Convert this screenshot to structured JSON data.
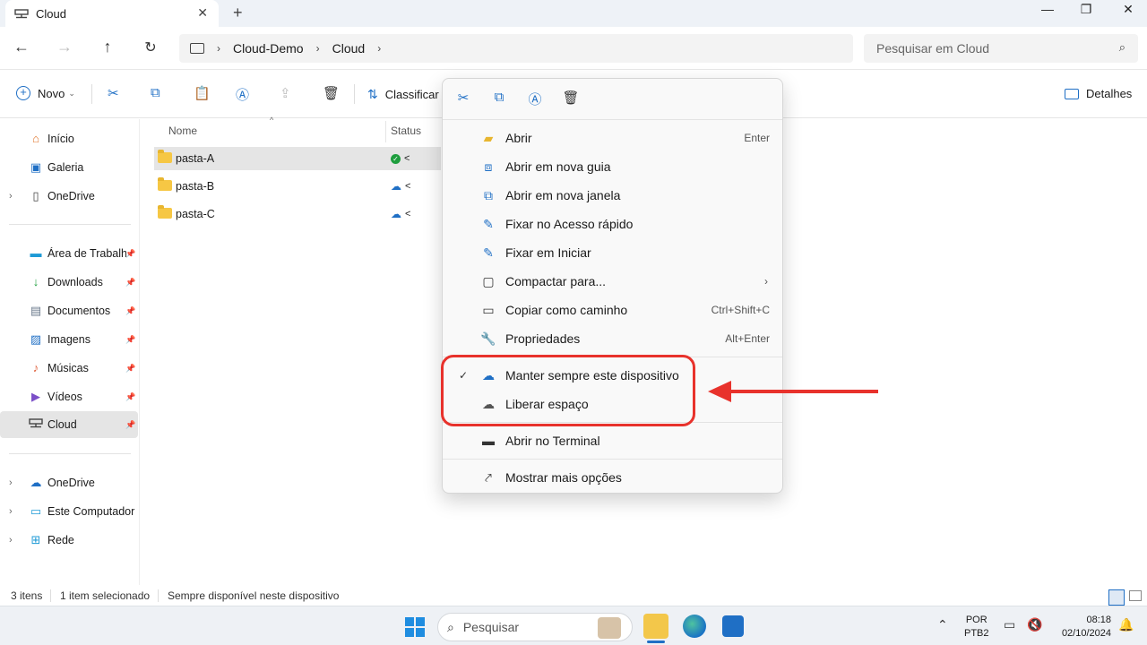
{
  "window": {
    "tab_title": "Cloud",
    "tab_icon": "network-drive-icon",
    "new_tab": "+",
    "minimize": "—",
    "maximize": "❐",
    "close": "✕"
  },
  "address": {
    "breadcrumbs": [
      "Cloud-Demo",
      "Cloud"
    ],
    "search_placeholder": "Pesquisar em Cloud"
  },
  "commandbar": {
    "new_label": "Novo",
    "sort_label": "Classificar",
    "details_label": "Detalhes"
  },
  "sidebar": {
    "items": [
      {
        "label": "Início",
        "icon": "home-icon",
        "color": "#e0762b"
      },
      {
        "label": "Galeria",
        "icon": "gallery-icon",
        "color": "#1f6fc5"
      },
      {
        "label": "OneDrive",
        "icon": "document-icon",
        "color": "#444"
      },
      {
        "label": "Área de Trabalho",
        "icon": "desktop-icon",
        "color": "#1e9ad6"
      },
      {
        "label": "Downloads",
        "icon": "download-icon",
        "color": "#1e9e3e"
      },
      {
        "label": "Documentos",
        "icon": "documents-icon",
        "color": "#6b7a8c"
      },
      {
        "label": "Imagens",
        "icon": "pictures-icon",
        "color": "#1f6fc5"
      },
      {
        "label": "Músicas",
        "icon": "music-icon",
        "color": "#e0603b"
      },
      {
        "label": "Vídeos",
        "icon": "videos-icon",
        "color": "#7b4fc8"
      },
      {
        "label": "Cloud",
        "icon": "network-drive-icon",
        "color": "#444"
      },
      {
        "label": "OneDrive",
        "icon": "onedrive-icon",
        "color": "#1f6fc5"
      },
      {
        "label": "Este Computador",
        "icon": "computer-icon",
        "color": "#1e9ad6"
      },
      {
        "label": "Rede",
        "icon": "network-icon",
        "color": "#1e9ad6"
      }
    ]
  },
  "filelist": {
    "columns": {
      "name": "Nome",
      "status": "Status"
    },
    "rows": [
      {
        "name": "pasta-A",
        "status": "available-synced"
      },
      {
        "name": "pasta-B",
        "status": "cloud-only"
      },
      {
        "name": "pasta-C",
        "status": "cloud-only"
      }
    ]
  },
  "context_menu": {
    "items": [
      {
        "label": "Abrir",
        "shortcut": "Enter",
        "icon": "folder-open-icon"
      },
      {
        "label": "Abrir em nova guia",
        "shortcut": "",
        "icon": "new-tab-icon"
      },
      {
        "label": "Abrir em nova janela",
        "shortcut": "",
        "icon": "new-window-icon"
      },
      {
        "label": "Fixar no Acesso rápido",
        "shortcut": "",
        "icon": "pin-icon"
      },
      {
        "label": "Fixar em Iniciar",
        "shortcut": "",
        "icon": "pin-icon"
      },
      {
        "label": "Compactar para...",
        "shortcut": "",
        "icon": "zip-icon"
      },
      {
        "label": "Copiar como caminho",
        "shortcut": "Ctrl+Shift+C",
        "icon": "copy-path-icon"
      },
      {
        "label": "Propriedades",
        "shortcut": "Alt+Enter",
        "icon": "wrench-icon"
      },
      {
        "label": "Manter sempre este dispositivo",
        "shortcut": "",
        "icon": "cloud-keep-icon"
      },
      {
        "label": "Liberar espaço",
        "shortcut": "",
        "icon": "cloud-icon"
      },
      {
        "label": "Abrir no Terminal",
        "shortcut": "",
        "icon": "terminal-icon"
      },
      {
        "label": "Mostrar mais opções",
        "shortcut": "",
        "icon": "more-options-icon"
      }
    ]
  },
  "statusbar": {
    "count": "3 itens",
    "selected": "1 item selecionado",
    "availability": "Sempre disponível neste dispositivo"
  },
  "taskbar": {
    "search_label": "Pesquisar",
    "lang_line1": "POR",
    "lang_line2": "PTB2",
    "time": "08:18",
    "date": "02/10/2024"
  },
  "colors": {
    "accent": "#1f6fc5",
    "highlight_red": "#e8322c",
    "selection": "#e5e5e5"
  }
}
